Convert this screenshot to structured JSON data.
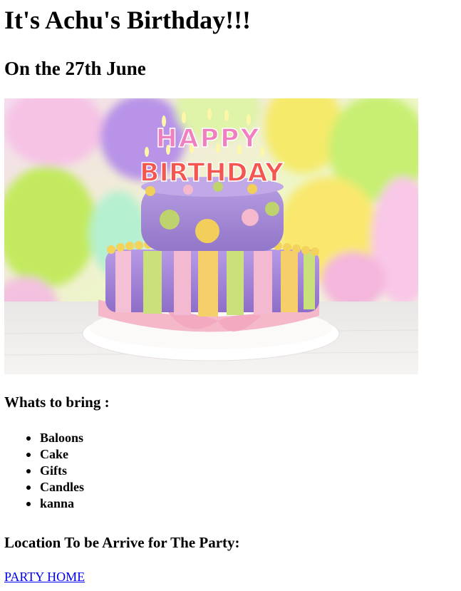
{
  "page": {
    "title": "It's Achu's Birthday!!!",
    "subtitle": "On the 27th June"
  },
  "image": {
    "icon": "birthday-cake-photo",
    "cake_text_line1": "HAPPY",
    "cake_text_line2": "BIRTHDAY",
    "colors": {
      "cake_purple": "#a98bd6",
      "balloon_green": "#c6ee6a",
      "balloon_yellow": "#f6ea63",
      "balloon_pink": "#f3a6d4",
      "ribbon_pink": "#f5b8c9"
    }
  },
  "bring": {
    "heading": "Whats to bring :",
    "items": [
      "Baloons",
      "Cake",
      "Gifts",
      "Candles",
      "kanna"
    ]
  },
  "location": {
    "heading": "Location To be Arrive for The Party:",
    "link_label": "PARTY HOME"
  }
}
